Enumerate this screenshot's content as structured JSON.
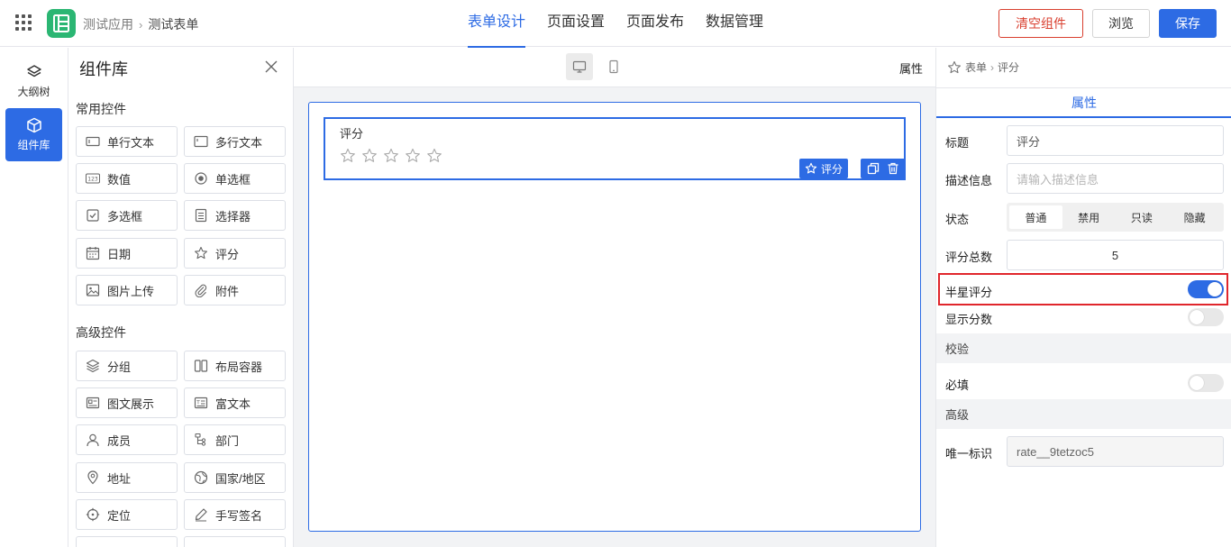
{
  "header": {
    "breadcrumb": [
      "测试应用",
      "测试表单"
    ],
    "tabs": [
      "表单设计",
      "页面设置",
      "页面发布",
      "数据管理"
    ],
    "active_tab": "表单设计",
    "buttons": {
      "clear": "清空组件",
      "preview": "浏览",
      "save": "保存"
    }
  },
  "rail": {
    "items": [
      "大纲树",
      "组件库"
    ],
    "active": "组件库"
  },
  "library": {
    "title": "组件库",
    "sections": [
      {
        "title": "常用控件",
        "items": [
          "单行文本",
          "多行文本",
          "数值",
          "单选框",
          "多选框",
          "选择器",
          "日期",
          "评分",
          "图片上传",
          "附件"
        ]
      },
      {
        "title": "高级控件",
        "items": [
          "分组",
          "布局容器",
          "图文展示",
          "富文本",
          "成员",
          "部门",
          "地址",
          "国家/地区",
          "定位",
          "手写签名"
        ]
      }
    ]
  },
  "canvas": {
    "header_label": "属性",
    "field": {
      "label": "评分",
      "tag": "评分",
      "stars": 5
    }
  },
  "props": {
    "breadcrumb": [
      "表单",
      "评分"
    ],
    "tab": "属性",
    "title_label": "标题",
    "title_value": "评分",
    "desc_label": "描述信息",
    "desc_placeholder": "请输入描述信息",
    "state_label": "状态",
    "state_options": [
      "普通",
      "禁用",
      "只读",
      "隐藏"
    ],
    "state_selected": "普通",
    "total_label": "评分总数",
    "total_value": "5",
    "half_label": "半星评分",
    "half_on": true,
    "show_label": "显示分数",
    "show_on": false,
    "validate_group": "校验",
    "required_label": "必填",
    "required_on": false,
    "advanced_group": "高级",
    "id_label": "唯一标识",
    "id_value": "rate__9tetzoc5"
  },
  "colors": {
    "accent": "#2d6be4",
    "danger": "#d93f2f",
    "highlight": "#e0262c",
    "logo": "#2bb673"
  }
}
